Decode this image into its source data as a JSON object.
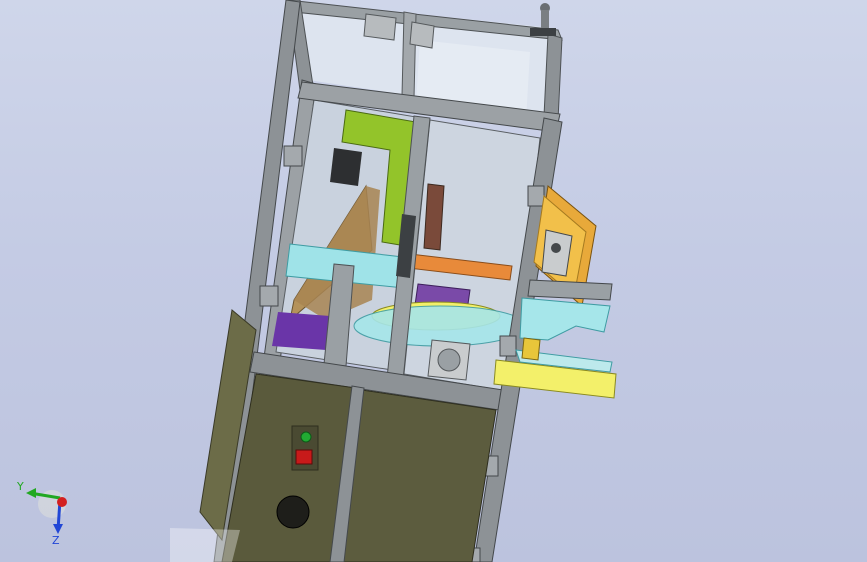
{
  "viewport": {
    "background_top": "#cfd6ea",
    "background_bottom": "#bcc3de"
  },
  "model": {
    "frame_color": "#8d9296",
    "frame_dark": "#55595c",
    "cabinet_color": "#5a5a3c",
    "glass_color": "#dfe6ef",
    "accent_green": "#93c42a",
    "accent_yellow": "#f3f06a",
    "accent_orange": "#e8a93a",
    "accent_purple": "#6a35a8",
    "accent_cyan": "#9fe3e8"
  },
  "triad": {
    "x_color": "#d32020",
    "y_color": "#21a821",
    "z_color": "#2146d6",
    "y_label": "Y",
    "z_label": "Z",
    "icons": [
      "axis-triad-icon",
      "origin-sphere-icon"
    ]
  },
  "cabinet_controls": {
    "indicator_color": "#22aa33",
    "estop_color": "#c81a1a",
    "icons": [
      "indicator-lamp-icon",
      "emergency-stop-icon",
      "cable-port-icon"
    ]
  }
}
